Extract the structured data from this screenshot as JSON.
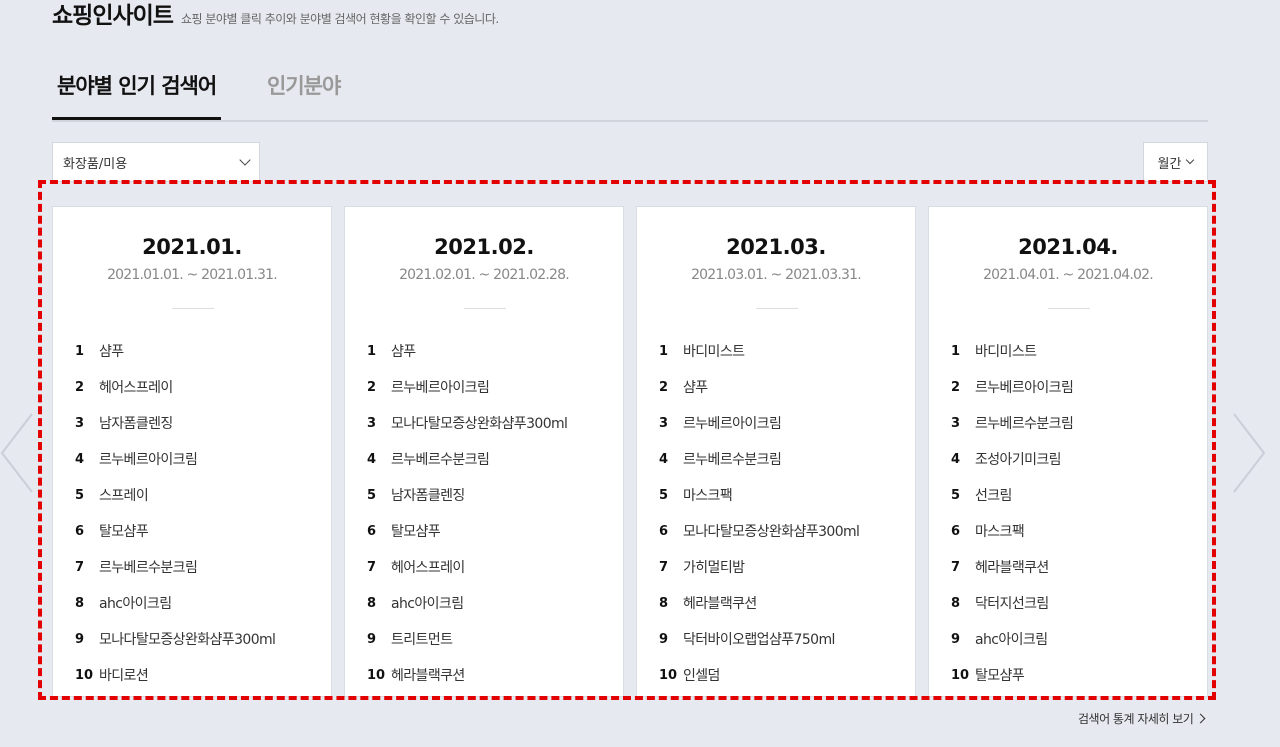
{
  "header": {
    "title": "쇼핑인사이트",
    "description": "쇼핑 분야별 클릭 추이와 분야별 검색어 현황을 확인할 수 있습니다."
  },
  "tabs": [
    {
      "label": "분야별 인기 검색어",
      "active": true
    },
    {
      "label": "인기분야",
      "active": false
    }
  ],
  "filters": {
    "category": "화장품/미용",
    "period": "월간"
  },
  "cards": [
    {
      "title": "2021.01.",
      "range": "2021.01.01. ~ 2021.01.31.",
      "items": [
        {
          "rank": "1",
          "keyword": "샴푸"
        },
        {
          "rank": "2",
          "keyword": "헤어스프레이"
        },
        {
          "rank": "3",
          "keyword": "남자폼클렌징"
        },
        {
          "rank": "4",
          "keyword": "르누베르아이크림"
        },
        {
          "rank": "5",
          "keyword": "스프레이"
        },
        {
          "rank": "6",
          "keyword": "탈모샴푸"
        },
        {
          "rank": "7",
          "keyword": "르누베르수분크림"
        },
        {
          "rank": "8",
          "keyword": "ahc아이크림"
        },
        {
          "rank": "9",
          "keyword": "모나다탈모증상완화샴푸300ml"
        },
        {
          "rank": "10",
          "keyword": "바디로션"
        }
      ]
    },
    {
      "title": "2021.02.",
      "range": "2021.02.01. ~ 2021.02.28.",
      "items": [
        {
          "rank": "1",
          "keyword": "샴푸"
        },
        {
          "rank": "2",
          "keyword": "르누베르아이크림"
        },
        {
          "rank": "3",
          "keyword": "모나다탈모증상완화샴푸300ml"
        },
        {
          "rank": "4",
          "keyword": "르누베르수분크림"
        },
        {
          "rank": "5",
          "keyword": "남자폼클렌징"
        },
        {
          "rank": "6",
          "keyword": "탈모샴푸"
        },
        {
          "rank": "7",
          "keyword": "헤어스프레이"
        },
        {
          "rank": "8",
          "keyword": "ahc아이크림"
        },
        {
          "rank": "9",
          "keyword": "트리트먼트"
        },
        {
          "rank": "10",
          "keyword": "헤라블랙쿠션"
        }
      ]
    },
    {
      "title": "2021.03.",
      "range": "2021.03.01. ~ 2021.03.31.",
      "items": [
        {
          "rank": "1",
          "keyword": "바디미스트"
        },
        {
          "rank": "2",
          "keyword": "샴푸"
        },
        {
          "rank": "3",
          "keyword": "르누베르아이크림"
        },
        {
          "rank": "4",
          "keyword": "르누베르수분크림"
        },
        {
          "rank": "5",
          "keyword": "마스크팩"
        },
        {
          "rank": "6",
          "keyword": "모나다탈모증상완화샴푸300ml"
        },
        {
          "rank": "7",
          "keyword": "가히멀티밤"
        },
        {
          "rank": "8",
          "keyword": "헤라블랙쿠션"
        },
        {
          "rank": "9",
          "keyword": "닥터바이오랩업샴푸750ml"
        },
        {
          "rank": "10",
          "keyword": "인셀덤"
        }
      ]
    },
    {
      "title": "2021.04.",
      "range": "2021.04.01. ~ 2021.04.02.",
      "items": [
        {
          "rank": "1",
          "keyword": "바디미스트"
        },
        {
          "rank": "2",
          "keyword": "르누베르아이크림"
        },
        {
          "rank": "3",
          "keyword": "르누베르수분크림"
        },
        {
          "rank": "4",
          "keyword": "조성아기미크림"
        },
        {
          "rank": "5",
          "keyword": "선크림"
        },
        {
          "rank": "6",
          "keyword": "마스크팩"
        },
        {
          "rank": "7",
          "keyword": "헤라블랙쿠션"
        },
        {
          "rank": "8",
          "keyword": "닥터지선크림"
        },
        {
          "rank": "9",
          "keyword": "ahc아이크림"
        },
        {
          "rank": "10",
          "keyword": "탈모샴푸"
        }
      ]
    }
  ],
  "more_link": "검색어 통계 자세히 보기",
  "colors": {
    "background": "#e6e9ef",
    "highlight": "#e30000",
    "card": "#ffffff"
  }
}
